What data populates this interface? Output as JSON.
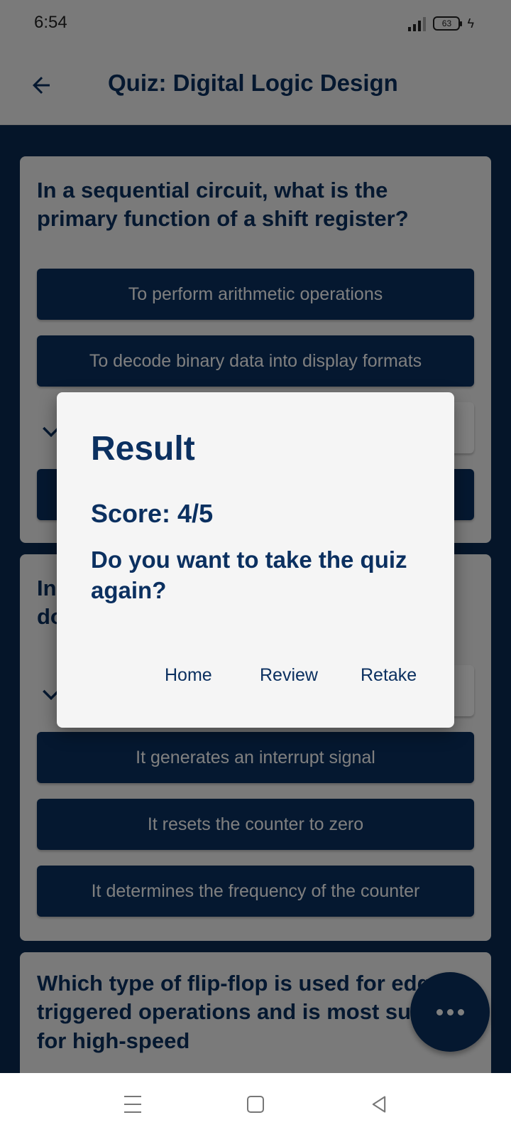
{
  "status_bar": {
    "time": "6:54",
    "battery": "63"
  },
  "app_bar": {
    "title": "Quiz: Digital Logic Design"
  },
  "questions": [
    {
      "text": "In a sequential circuit, what is the primary function of a shift register?",
      "options": [
        "To perform arithmetic operations",
        "To decode binary data into display formats",
        "",
        ""
      ]
    },
    {
      "text_lines": [
        "In",
        "do"
      ],
      "options": [
        "",
        "It generates an interrupt signal",
        "It resets the counter to zero",
        "It determines the frequency of the counter"
      ]
    },
    {
      "text": "Which type of flip-flop is used for edge-triggered operations and is most suitable for high-speed"
    }
  ],
  "dialog": {
    "title": "Result",
    "score": "Score: 4/5",
    "message": "Do you want to take the quiz again?",
    "buttons": {
      "home": "Home",
      "review": "Review",
      "retake": "Retake"
    }
  },
  "icons": {
    "back": "arrow-left-icon",
    "check": "check-icon",
    "fab": "more-horizontal-icon",
    "nav_menu": "menu-icon",
    "nav_home": "square-icon",
    "nav_back": "triangle-back-icon"
  },
  "colors": {
    "primary": "#0b3060",
    "surface": "#f5f5f5"
  }
}
